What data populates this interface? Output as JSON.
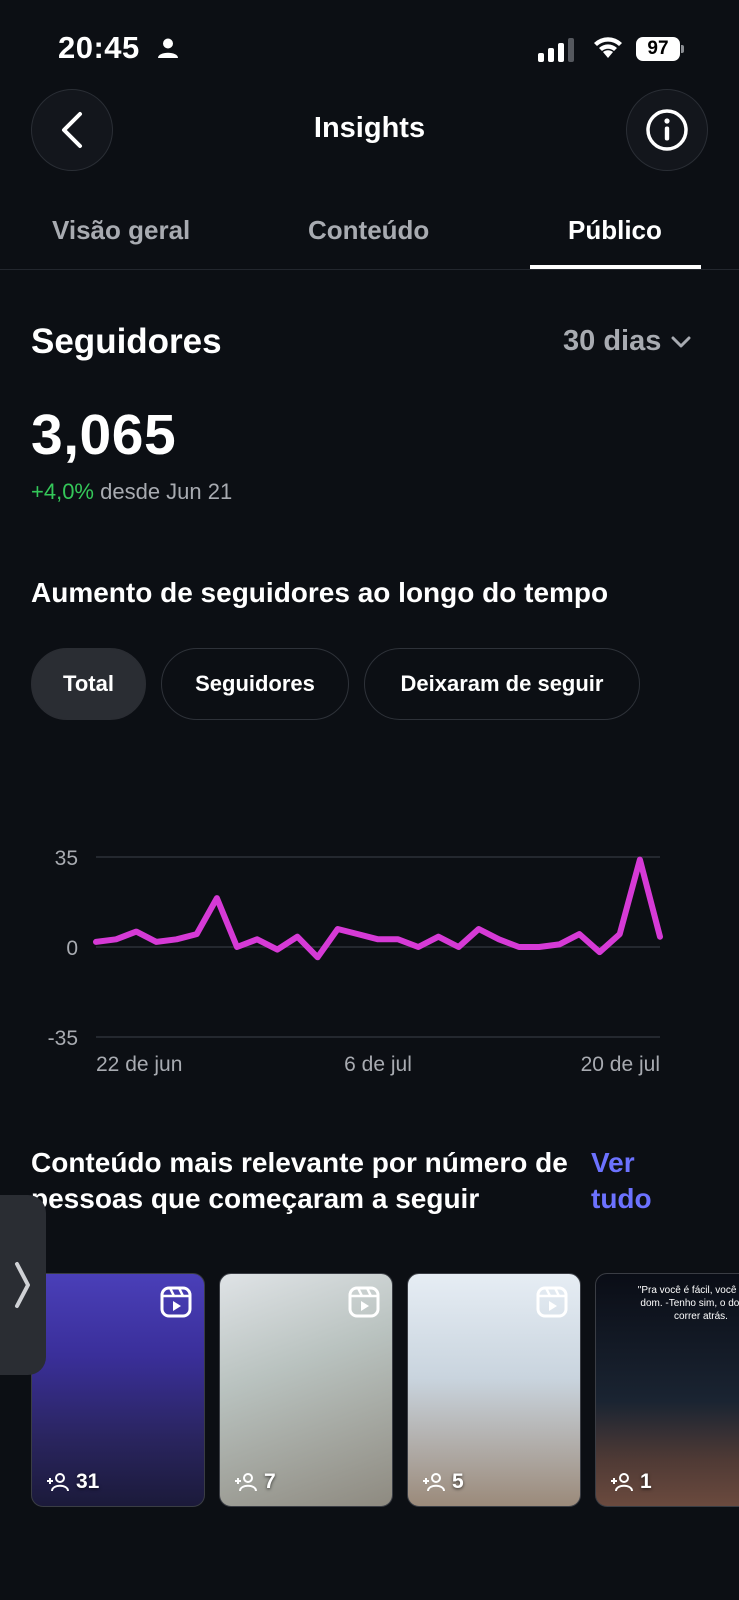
{
  "status_bar": {
    "time": "20:45",
    "battery": "97"
  },
  "nav": {
    "title": "Insights"
  },
  "tabs": [
    {
      "label": "Visão geral",
      "active": false
    },
    {
      "label": "Conteúdo",
      "active": false
    },
    {
      "label": "Público",
      "active": true
    }
  ],
  "followers": {
    "title": "Seguidores",
    "period": "30 dias",
    "count": "3,065",
    "change": "+4,0%",
    "since": "desde Jun 21"
  },
  "growth": {
    "title": "Aumento de seguidores ao longo do tempo",
    "filters": [
      "Total",
      "Seguidores",
      "Deixaram de seguir"
    ],
    "selected_filter": "Total"
  },
  "chart_data": {
    "type": "line",
    "ytick_labels": [
      "35",
      "0",
      "-35"
    ],
    "ylim": [
      -35,
      35
    ],
    "xtick_labels": [
      "22 de jun",
      "6 de jul",
      "20 de jul"
    ],
    "series": [
      {
        "color": "#d63ad6",
        "values": [
          2,
          3,
          6,
          2,
          3,
          5,
          19,
          0,
          3,
          -1,
          4,
          -4,
          7,
          5,
          3,
          3,
          0,
          4,
          0,
          7,
          3,
          0,
          0,
          1,
          5,
          -2,
          5,
          34,
          4
        ]
      }
    ]
  },
  "relevant": {
    "title": "Conteúdo mais relevante por número de pessoas que começaram a seguir",
    "see_all": "Ver tudo",
    "items": [
      {
        "type": "reel",
        "follows": "31"
      },
      {
        "type": "reel",
        "follows": "7"
      },
      {
        "type": "reel",
        "follows": "5"
      },
      {
        "type": "reel",
        "follows": "1",
        "caption": "\"Pra você é fácil, você tem o dom. -Tenho sim, o dom de correr atrás."
      }
    ]
  },
  "colors": {
    "accent_link": "#6c72ff",
    "positive": "#34c759",
    "line": "#d63ad6",
    "background": "#0c0f14"
  }
}
